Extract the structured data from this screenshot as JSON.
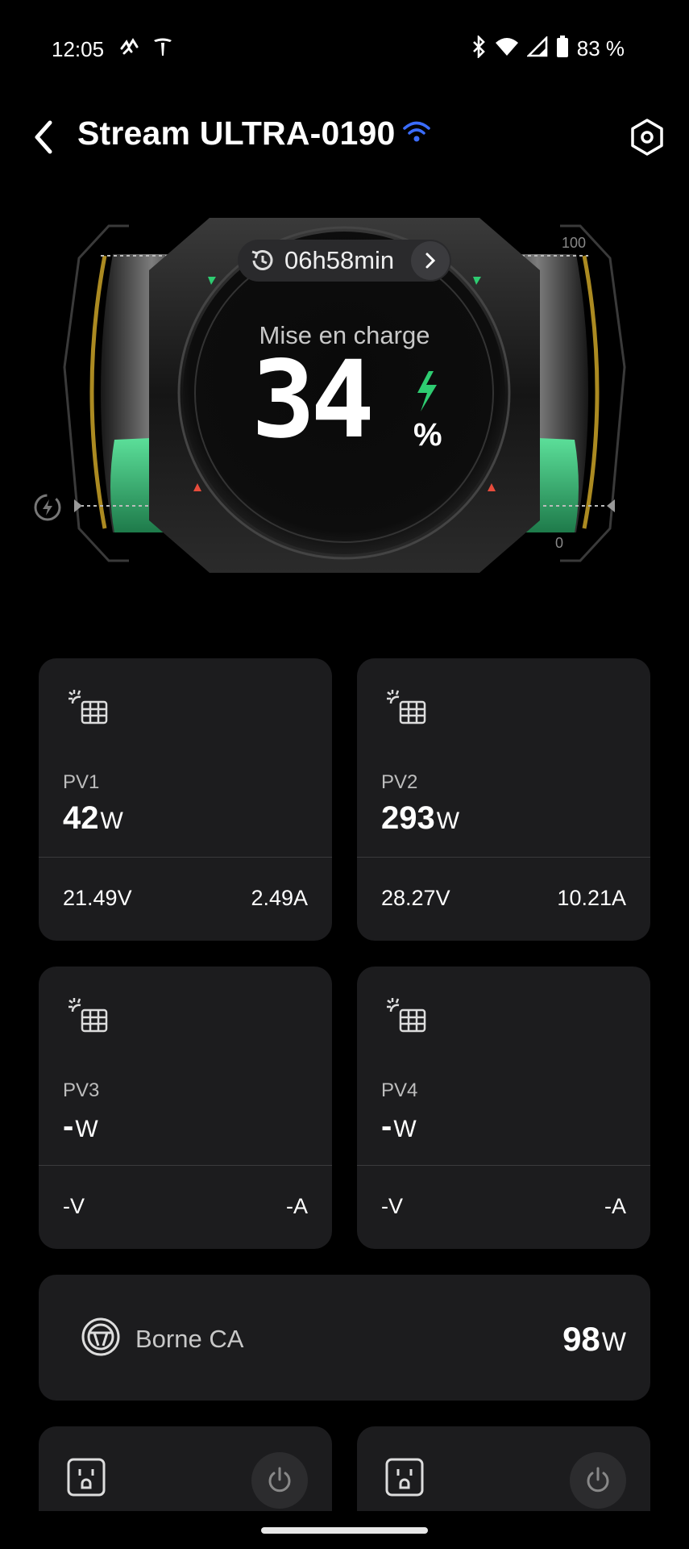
{
  "status_bar": {
    "time": "12:05",
    "battery_text": "83 %",
    "icons": [
      "pulse-icon",
      "tesla-icon",
      "bluetooth-icon",
      "wifi-icon",
      "signal-icon",
      "battery-icon"
    ]
  },
  "header": {
    "title": "Stream ULTRA-0190",
    "connection_icon": "wifi-icon",
    "accent_color": "#3b6dff"
  },
  "gauge": {
    "runtime": "06h58min",
    "state_label": "Mise en charge",
    "battery_percent": 34,
    "battery_value_text": "34",
    "unit": "%",
    "scale_max": "100",
    "scale_min": "0",
    "fill_color": "#2ecc71",
    "bar_color": "#c9a227"
  },
  "pv_panels": [
    {
      "name": "PV1",
      "power": "42",
      "power_unit": "W",
      "voltage": "21.49V",
      "current": "2.49A"
    },
    {
      "name": "PV2",
      "power": "293",
      "power_unit": "W",
      "voltage": "28.27V",
      "current": "10.21A"
    },
    {
      "name": "PV3",
      "power": "-",
      "power_unit": "W",
      "voltage": "-V",
      "current": "-A"
    },
    {
      "name": "PV4",
      "power": "-",
      "power_unit": "W",
      "voltage": "-V",
      "current": "-A"
    }
  ],
  "ac_input": {
    "label": "Borne CA",
    "power": "98",
    "power_unit": "W"
  }
}
